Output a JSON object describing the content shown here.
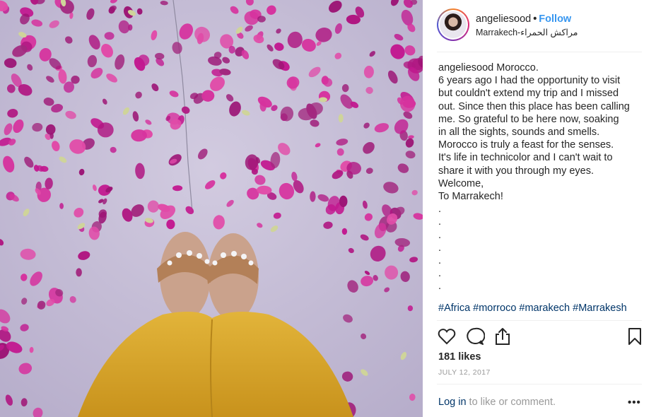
{
  "post": {
    "username": "angeliesood",
    "separator": "•",
    "follow_label": "Follow",
    "location": "Marrakech-مراكش الحمراء"
  },
  "caption": {
    "author": "angeliesood",
    "first_line_rest": "Morocco.",
    "lines": [
      "6 years ago I had the opportunity to visit",
      "but couldn't extend my trip and I missed",
      "out. Since then this place has been calling",
      "me. So grateful to be here now, soaking",
      "in all the sights, sounds and smells.",
      "Morocco is truly a feast for the senses.",
      "It's life in technicolor and I can't wait to",
      "share it with you through my eyes.",
      "Welcome,",
      "To Marrakech!",
      ".",
      ".",
      ".",
      ".",
      ".",
      ".",
      "."
    ],
    "hashtags": [
      "#Africa",
      "#morroco",
      "#marakech",
      "#Marrakesh"
    ]
  },
  "stats": {
    "likes": "181 likes",
    "date": "JULY 12, 2017"
  },
  "comment_bar": {
    "login_label": "Log in",
    "rest_text": " to like or comment.",
    "more_label": "•••"
  },
  "icons": {
    "like": "heart-icon",
    "comment": "comment-icon",
    "share": "share-icon",
    "save": "bookmark-icon",
    "more": "more-options-icon"
  },
  "colors": {
    "link": "#3897f0",
    "hashtag": "#003569",
    "muted": "#999999",
    "petal": "#c2188f",
    "floor": "#c7bfd6",
    "pants": "#d9a52a"
  }
}
